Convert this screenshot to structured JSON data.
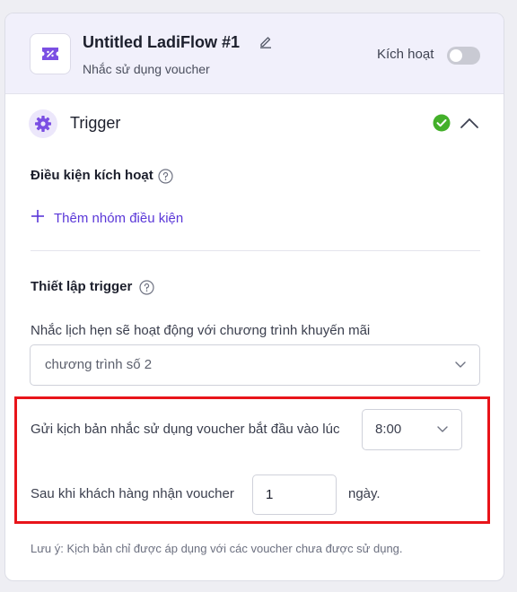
{
  "flow": {
    "title": "Untitled LadiFlow #1",
    "subtitle": "Nhắc sử dụng voucher",
    "activate_label": "Kích hoạt",
    "activated": false
  },
  "trigger": {
    "title": "Trigger",
    "status": "valid",
    "expanded": true,
    "condition_label": "Điều kiện kích hoạt",
    "add_group_label": "Thêm nhóm điều kiện",
    "setup_label": "Thiết lập trigger",
    "program_label": "Nhắc lịch hẹn sẽ hoạt động với chương trình khuyến mãi",
    "program_value": "chương trình số 2",
    "send_label": "Gửi kịch bản nhắc sử dụng voucher bắt đầu vào lúc",
    "send_time": "8:00",
    "after_label": "Sau khi khách hàng nhận voucher",
    "days_value": "1",
    "days_unit": "ngày.",
    "note": "Lưu ý: Kịch bản chỉ được áp dụng với các voucher chưa được sử dụng."
  },
  "colors": {
    "accent": "#7b4fe3",
    "link": "#5a37d8",
    "success": "#43b02a",
    "highlight": "#e8141a"
  },
  "icons": {
    "app": "voucher-ticket-icon",
    "edit": "pencil-icon",
    "trigger": "gear-icon",
    "status": "check-circle-icon",
    "collapse": "chevron-up-icon",
    "help": "question-circle-icon",
    "add": "plus-icon",
    "dropdown": "chevron-down-icon"
  }
}
